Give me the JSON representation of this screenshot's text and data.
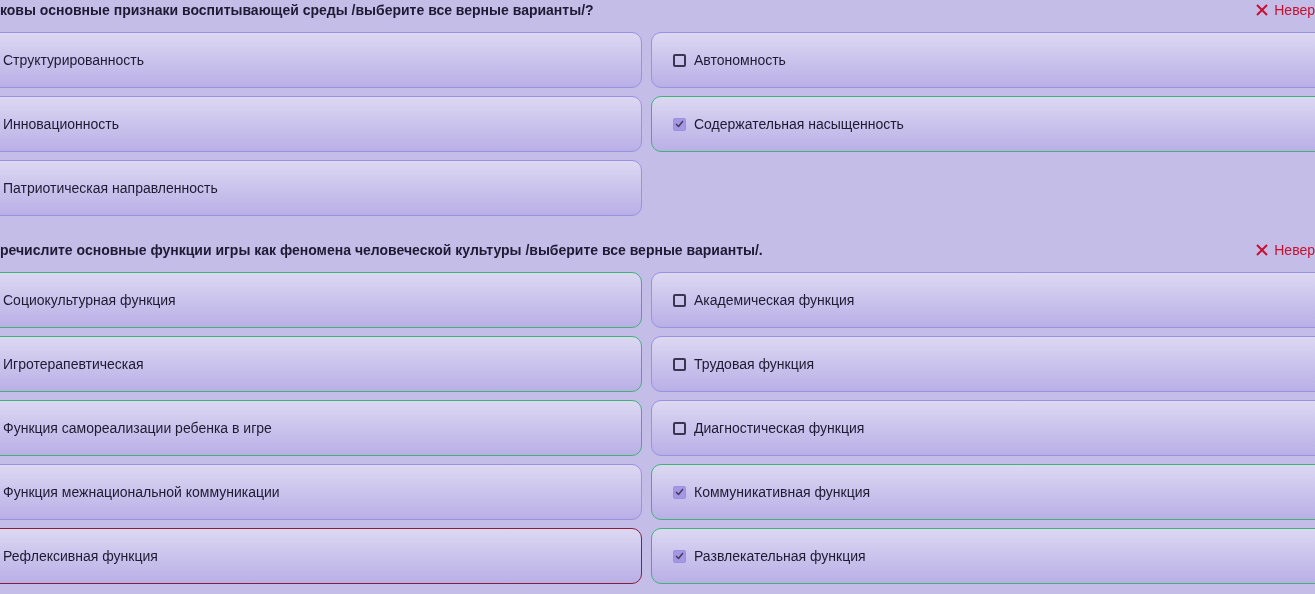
{
  "questions": [
    {
      "text": "ковы основные признаки воспитывающей среды /выберите все верные варианты/?",
      "verdict": "Невер",
      "options": [
        {
          "label": "Структурированность",
          "kind": "plain",
          "color": "#9a91e2"
        },
        {
          "label": "Автономность",
          "kind": "checkbox",
          "checked": false,
          "color": "#9a91e2"
        },
        {
          "label": "Инновационность",
          "kind": "plain",
          "color": "#9a91e2"
        },
        {
          "label": "Содержательная насыщенность",
          "kind": "checkbox",
          "checked": true,
          "color": "#3fb27a"
        },
        {
          "label": "Патриотическая направленность",
          "kind": "plain",
          "color": "#9a91e2"
        }
      ]
    },
    {
      "text": "речислите основные функции игры как феномена человеческой культуры /выберите все верные варианты/.",
      "verdict": "Невер",
      "options": [
        {
          "label": "Социокультурная функция",
          "kind": "plain",
          "color": "#3fb27a"
        },
        {
          "label": "Академическая функция",
          "kind": "checkbox",
          "checked": false,
          "color": "#9a91e2"
        },
        {
          "label": "Игротерапевтическая",
          "kind": "plain",
          "color": "#3fb27a"
        },
        {
          "label": "Трудовая функция",
          "kind": "checkbox",
          "checked": false,
          "color": "#9a91e2"
        },
        {
          "label": "Функция самореализации ребенка в игре",
          "kind": "plain",
          "color": "#3fb27a"
        },
        {
          "label": "Диагностическая функция",
          "kind": "checkbox",
          "checked": false,
          "color": "#9a91e2"
        },
        {
          "label": "Функция межнациональной коммуникации",
          "kind": "plain",
          "color": "#9a91e2"
        },
        {
          "label": "Коммуникативная функция",
          "kind": "checkbox",
          "checked": true,
          "color": "#3fb27a"
        },
        {
          "label": "Рефлексивная функция",
          "kind": "plain",
          "color": "#8a1c3c"
        },
        {
          "label": "Развлекательная функция",
          "kind": "checkbox",
          "checked": true,
          "color": "#3fb27a"
        }
      ]
    }
  ]
}
